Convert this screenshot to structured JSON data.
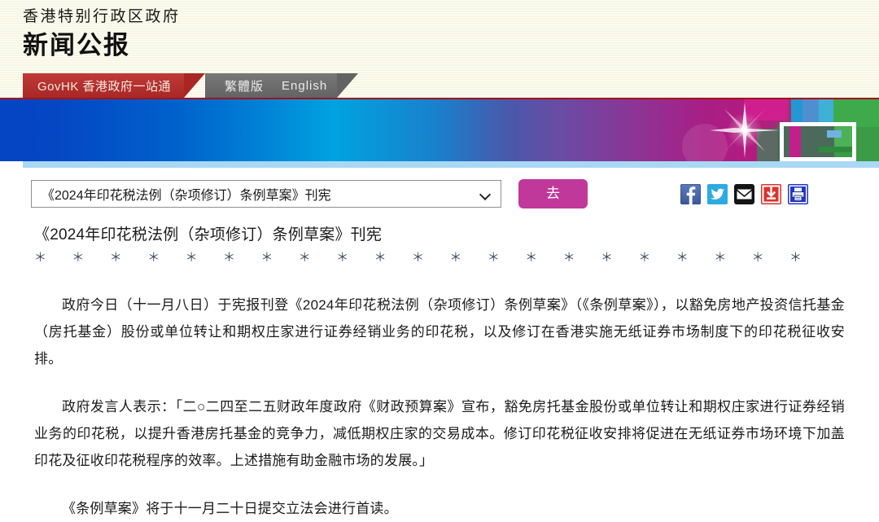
{
  "header": {
    "org_name": "香港特别行政区政府",
    "publication_name": "新闻公报",
    "tabs": {
      "govhk": "GovHK 香港政府一站通",
      "traditional": "繁體版",
      "english": "English"
    }
  },
  "toolbar": {
    "select_value": "《2024年印花税法例（杂项修订）条例草案》刊宪",
    "go_label": "去",
    "social": [
      {
        "name": "facebook-icon",
        "color": "#3b5998"
      },
      {
        "name": "twitter-icon",
        "color": "#2daae1"
      },
      {
        "name": "email-icon",
        "color": "#141414"
      },
      {
        "name": "download-icon",
        "color": "#d9352c"
      },
      {
        "name": "print-icon",
        "color": "#2338c8"
      }
    ]
  },
  "article": {
    "headline": "《2024年印花税法例（杂项修订）条例草案》刊宪",
    "star_rule": "＊　＊　＊　＊　＊　＊　＊　＊　＊　＊　＊　＊　＊　＊　＊　＊　＊　＊　＊　＊　＊",
    "paragraphs": [
      "政府今日（十一月八日）于宪报刊登《2024年印花税法例（杂项修订）条例草案》（《条例草案》），以豁免房地产投资信托基金（房托基金）股份或单位转让和期权庄家进行证券经销业务的印花税，以及修订在香港实施无纸证券市场制度下的印花税征收安排。",
      "政府发言人表示：「二○二四至二五财政年度政府《财政预算案》宣布，豁免房托基金股份或单位转让和期权庄家进行证券经销业务的印花税，以提升香港房托基金的竞争力，减低期权庄家的交易成本。修订印花税征收安排将促进在无纸证券市场环境下加盖印花及征收印花税程序的效率。上述措施有助金融市场的发展。」",
      "《条例草案》将于十一月二十日提交立法会进行首读。"
    ]
  },
  "colors": {
    "header_bg": "#f9f9e9",
    "accent_red": "#a82725",
    "tab_gray": "#6d6d6d",
    "go_button": "#c0399a",
    "underline_blue": "#a8d8f3"
  }
}
